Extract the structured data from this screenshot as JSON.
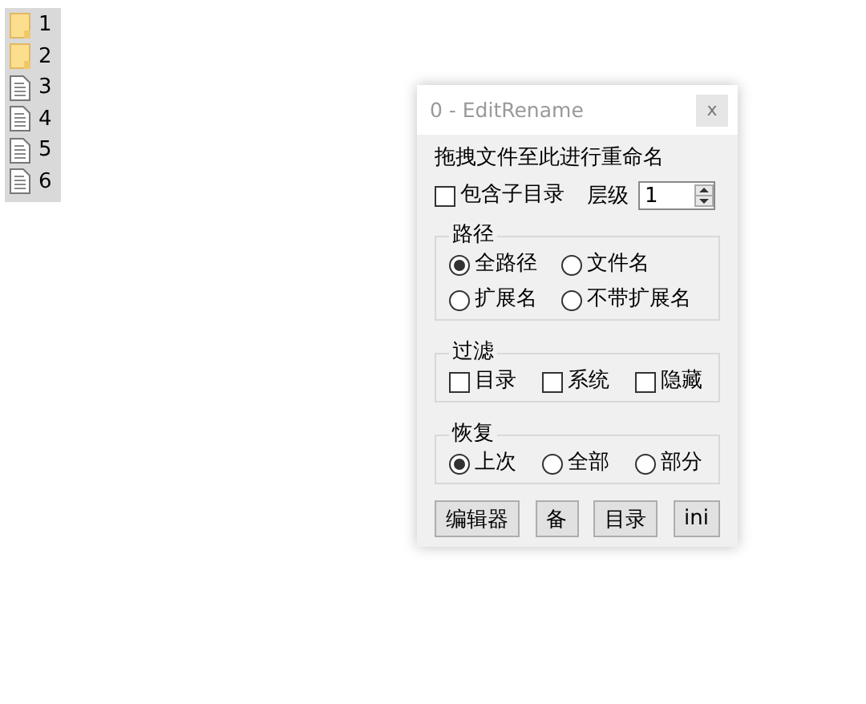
{
  "files": [
    {
      "kind": "folder",
      "label": "1"
    },
    {
      "kind": "folder",
      "label": "2"
    },
    {
      "kind": "file",
      "label": "3"
    },
    {
      "kind": "file",
      "label": "4"
    },
    {
      "kind": "file",
      "label": "5"
    },
    {
      "kind": "file",
      "label": "6"
    }
  ],
  "window": {
    "title": "0 - EditRename",
    "close": "x",
    "instruction": "拖拽文件至此进行重命名",
    "subdir": {
      "label": "包含子目录",
      "checked": false
    },
    "level_label": "层级",
    "level_value": "1",
    "groups": [
      {
        "title": "路径",
        "kind": "radio",
        "options": [
          {
            "label": "全路径",
            "selected": true
          },
          {
            "label": "文件名",
            "selected": false
          },
          {
            "label": "扩展名",
            "selected": false
          },
          {
            "label": "不带扩展名",
            "selected": false
          }
        ]
      },
      {
        "title": "过滤",
        "kind": "check",
        "options": [
          {
            "label": "目录",
            "checked": false
          },
          {
            "label": "系统",
            "checked": false
          },
          {
            "label": "隐藏",
            "checked": false
          }
        ]
      },
      {
        "title": "恢复",
        "kind": "radio",
        "options": [
          {
            "label": "上次",
            "selected": true
          },
          {
            "label": "全部",
            "selected": false
          },
          {
            "label": "部分",
            "selected": false
          }
        ]
      }
    ],
    "buttons": [
      "编辑器",
      "备",
      "目录",
      "ini"
    ]
  }
}
